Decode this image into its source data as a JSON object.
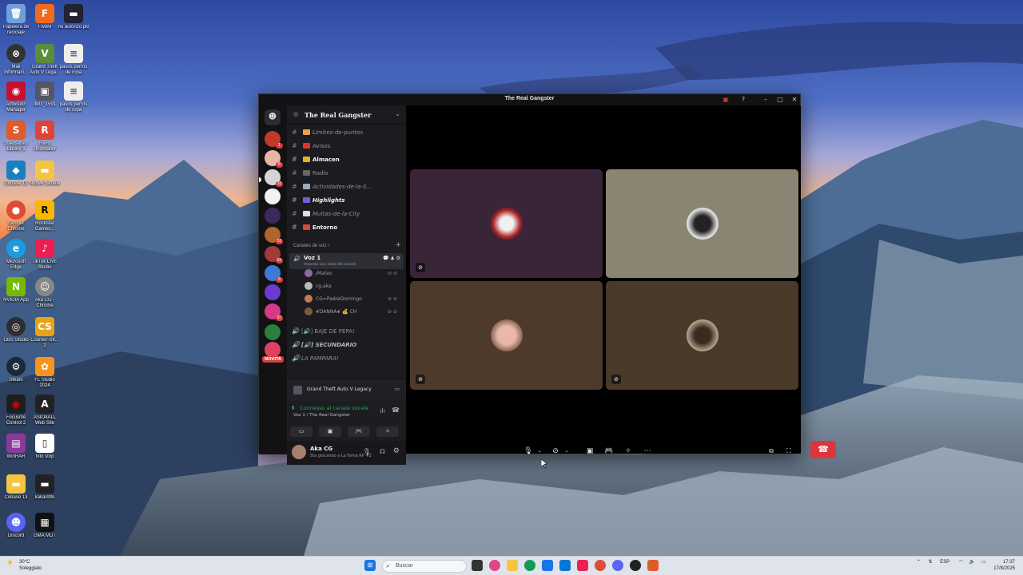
{
  "desktop": {
    "icons": [
      {
        "label": "Papelera de reciclaje"
      },
      {
        "label": "FiveM"
      },
      {
        "label": "no autorizo.pkl"
      },
      {
        "label": "Mail Informaci..."
      },
      {
        "label": "Grand Theft Auto V Lega..."
      },
      {
        "label": "pasos perros de ropa"
      },
      {
        "label": "Activision Manager"
      },
      {
        "label": "IMG_1591"
      },
      {
        "label": "pasos perros de ropa"
      },
      {
        "label": "Steelseries Library 1"
      },
      {
        "label": "Revo Uninstaller"
      },
      {
        "label": "Cubase 13"
      },
      {
        "label": "Nuove cartelle"
      },
      {
        "label": "Google Chrome"
      },
      {
        "label": "Rockstar Games..."
      },
      {
        "label": "Microsoft Edge"
      },
      {
        "label": "TikTok LIVE Studio"
      },
      {
        "label": "NVIDIA App"
      },
      {
        "label": "Aka CG - Chrome"
      },
      {
        "label": "OBS Studio"
      },
      {
        "label": "Counter-Str... 2"
      },
      {
        "label": "Steam"
      },
      {
        "label": "FL Studio 2024"
      },
      {
        "label": "Focusrite Control 2"
      },
      {
        "label": "ASIO4ALL Web Site"
      },
      {
        "label": "WinRAR"
      },
      {
        "label": "foto strip"
      },
      {
        "label": "Cubase 13"
      },
      {
        "label": "kakarotto"
      },
      {
        "label": "Discord"
      },
      {
        "label": "GMA MDT"
      }
    ]
  },
  "window": {
    "title": "The Real Gangster"
  },
  "servers": {
    "badges": [
      "1",
      "8",
      "10",
      "",
      "",
      "52",
      "91",
      "8",
      "",
      "97",
      "",
      "",
      "NOVITÀ"
    ]
  },
  "sidebar": {
    "server_name": "The Real Gangster",
    "channels": [
      {
        "label": "Limites-de-puntos"
      },
      {
        "label": "Avisos"
      },
      {
        "label": "Almacen"
      },
      {
        "label": "Radio"
      },
      {
        "label": "Actividades-de-la-S..."
      },
      {
        "label": "Highlights"
      },
      {
        "label": "Multas-de-la-City"
      },
      {
        "label": "Entorno"
      }
    ],
    "voice_section": "Canales de voz",
    "voice_channel": {
      "name": "Voz 1",
      "status": "Imposta uno stato del canale"
    },
    "voice_users": [
      "/Mateo",
      "cg.aka",
      "CG=PadreDomingo",
      "ꗃDANNAꗃ 💰 CH"
    ],
    "other_voice": [
      "BAJE DE PEPA!",
      "SECUNDARIO",
      "LA PAMPARA!"
    ],
    "activity": "Grand Theft Auto V Legacy",
    "connected": "Connesso al canale vocale",
    "connected_sub": "Voz 1 / The Real Gangster",
    "user_name": "Aka CG",
    "user_status": "Sta giocando a La Fama RP +2"
  },
  "taskbar": {
    "weather_temp": "30°C",
    "weather_desc": "Soleggiato",
    "search_placeholder": "Buscar",
    "lang": "ESP",
    "time": "17:37",
    "date": "17/8/2025"
  },
  "colors": {
    "accent_red": "#da373c",
    "connected_green": "#23a55a"
  }
}
